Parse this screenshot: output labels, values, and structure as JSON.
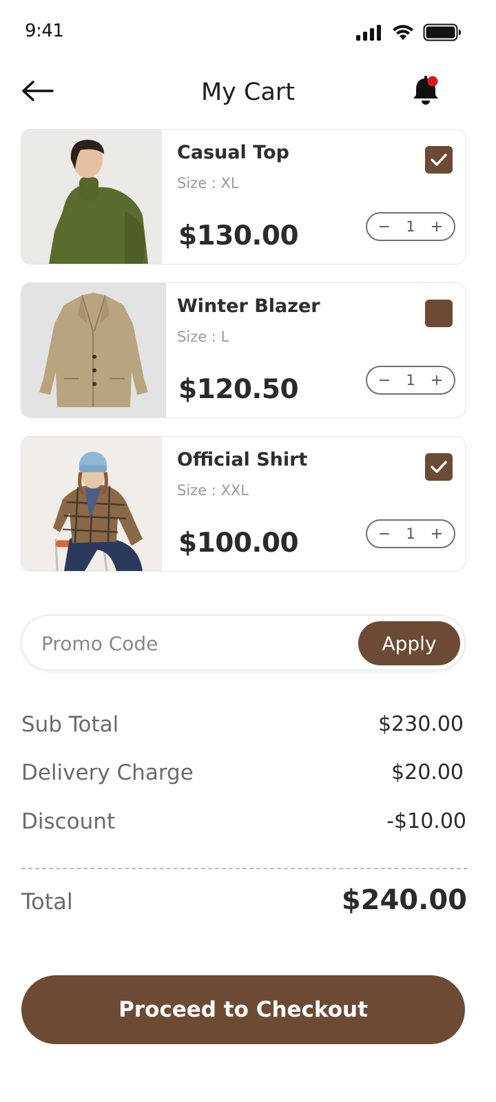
{
  "status_bar": {
    "time": "9:41"
  },
  "header": {
    "title": "My Cart"
  },
  "cart": {
    "items": [
      {
        "name": "Casual Top",
        "size": "Size : XL",
        "price": "$130.00",
        "quantity": "1",
        "checked": true
      },
      {
        "name": "Winter Blazer",
        "size": "Size : L",
        "price": "$120.50",
        "quantity": "1",
        "checked": false
      },
      {
        "name": "Official Shirt",
        "size": "Size : XXL",
        "price": "$100.00",
        "quantity": "1",
        "checked": true
      }
    ],
    "stepper_minus": "−",
    "stepper_plus": "+"
  },
  "promo": {
    "placeholder": "Promo Code",
    "apply_label": "Apply"
  },
  "summary": {
    "subtotal_label": "Sub Total",
    "subtotal_value": "$230.00",
    "delivery_label": "Delivery Charge",
    "delivery_value": "$20.00",
    "discount_label": "Discount",
    "discount_value": "-$10.00",
    "total_label": "Total",
    "total_value": "$240.00"
  },
  "checkout": {
    "label": "Proceed to Checkout"
  },
  "colors": {
    "accent": "#6d4a34",
    "notification": "#e0161b"
  },
  "icons": {
    "back": "arrow-left-icon",
    "notifications": "bell-icon",
    "check": "check-icon"
  }
}
